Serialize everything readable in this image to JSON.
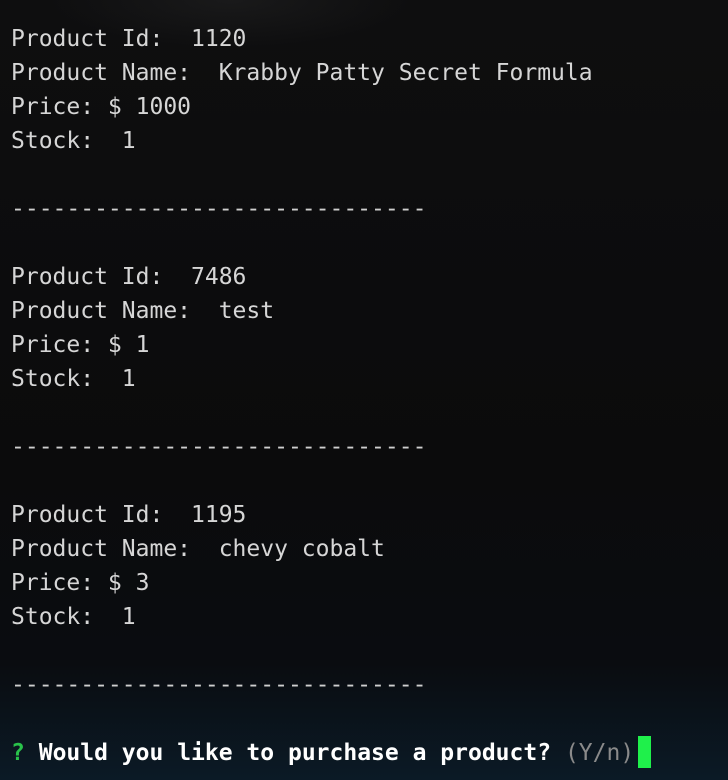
{
  "products": [
    {
      "id_line": "Product Id:  1120",
      "name_line": "Product Name:  Krabby Patty Secret Formula",
      "price_line": "Price: $ 1000",
      "stock_line": "Stock:  1"
    },
    {
      "id_line": "Product Id:  7486",
      "name_line": "Product Name:  test",
      "price_line": "Price: $ 1",
      "stock_line": "Stock:  1"
    },
    {
      "id_line": "Product Id:  1195",
      "name_line": "Product Name:  chevy cobalt",
      "price_line": "Price: $ 3",
      "stock_line": "Stock:  1"
    }
  ],
  "separator": "------------------------------",
  "prompt": {
    "marker": "?",
    "question": "Would you like to purchase a product?",
    "hint": "(Y/n)"
  },
  "colors": {
    "background": "#0c0c0d",
    "text": "#d6d6d6",
    "prompt_marker": "#29c24a",
    "cursor": "#1ff04b",
    "hint": "#8a8a8a"
  }
}
